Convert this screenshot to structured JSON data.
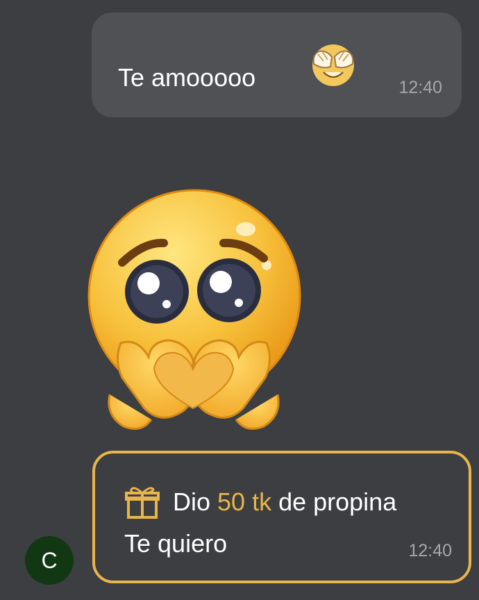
{
  "messages": [
    {
      "text": "Te amooooo",
      "emoji": "see-no-evil-face-icon",
      "time": "12:40"
    }
  ],
  "sticker": {
    "name": "pleading-face-heart-hands-sticker"
  },
  "gift_message": {
    "icon": "gift-icon",
    "prefix": "Dio ",
    "amount": "50 tk",
    "suffix": " de propina",
    "note": "Te quiero",
    "time": "12:40",
    "accent_color": "#e8b54c"
  },
  "avatar": {
    "initial": "C",
    "color": "#123813"
  },
  "colors": {
    "background": "#3d3e42",
    "bubble": "#505155",
    "time": "#a6a7ab"
  }
}
